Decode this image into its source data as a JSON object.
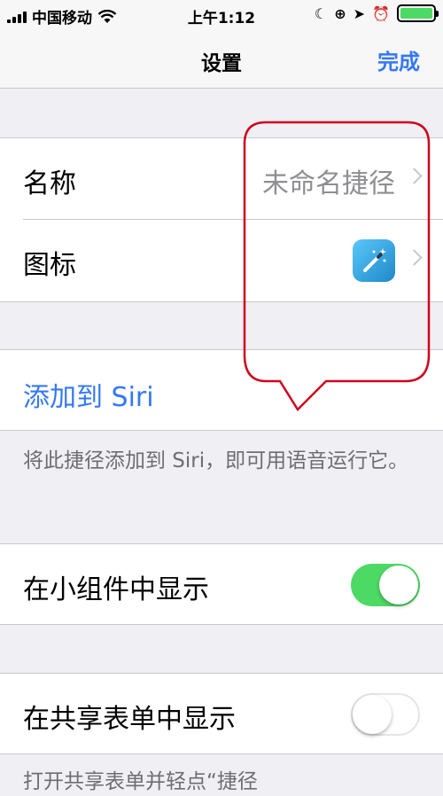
{
  "status": {
    "carrier": "中国移动",
    "time": "上午1:12"
  },
  "nav": {
    "title": "设置",
    "done_label": "完成"
  },
  "name_row": {
    "label": "名称",
    "value": "未命名捷径"
  },
  "icon_row": {
    "label": "图标",
    "icon": "magic-wand-icon"
  },
  "siri": {
    "label": "添加到 Siri",
    "footer": "将此捷径添加到 Siri，即可用语音运行它。"
  },
  "widget": {
    "label": "在小组件中显示",
    "enabled": true
  },
  "share": {
    "label": "在共享表单中显示",
    "enabled": false,
    "footer": "打开共享表单并轻点“捷径"
  },
  "colors": {
    "accent": "#3478f6",
    "toggle_on": "#4cd964",
    "annotation": "#d0021b"
  }
}
